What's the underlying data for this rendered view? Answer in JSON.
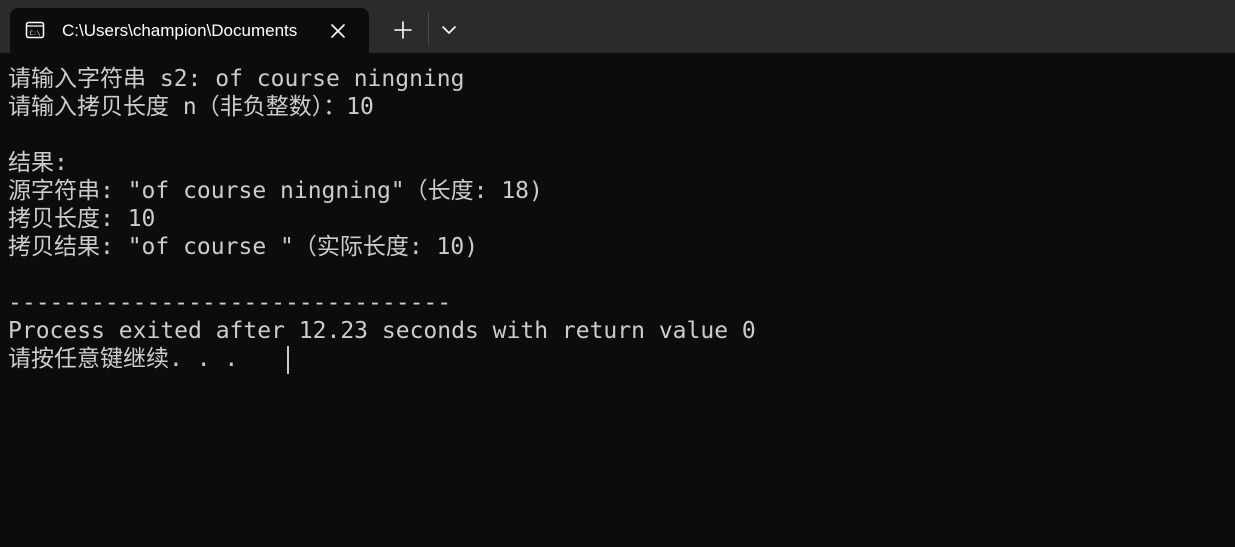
{
  "window": {
    "tab_title": "C:\\Users\\champion\\Documents",
    "icons": {
      "tab": "console-icon",
      "close": "close-icon",
      "new_tab": "plus-icon",
      "dropdown": "chevron-down-icon"
    }
  },
  "colors": {
    "background": "#0c0c0c",
    "titlebar": "#2b2b2b",
    "text": "#cccccc"
  },
  "console": {
    "lines": [
      "请输入字符串 s2: of course ningning",
      "请输入拷贝长度 n（非负整数）：10",
      "",
      "结果:",
      "源字符串: \"of course ningning\"（长度: 18)",
      "拷贝长度: 10",
      "拷贝结果: \"of course \"（实际长度: 10)",
      "",
      "--------------------------------",
      "Process exited after 12.23 seconds with return value 0",
      "请按任意键继续. . ."
    ]
  }
}
